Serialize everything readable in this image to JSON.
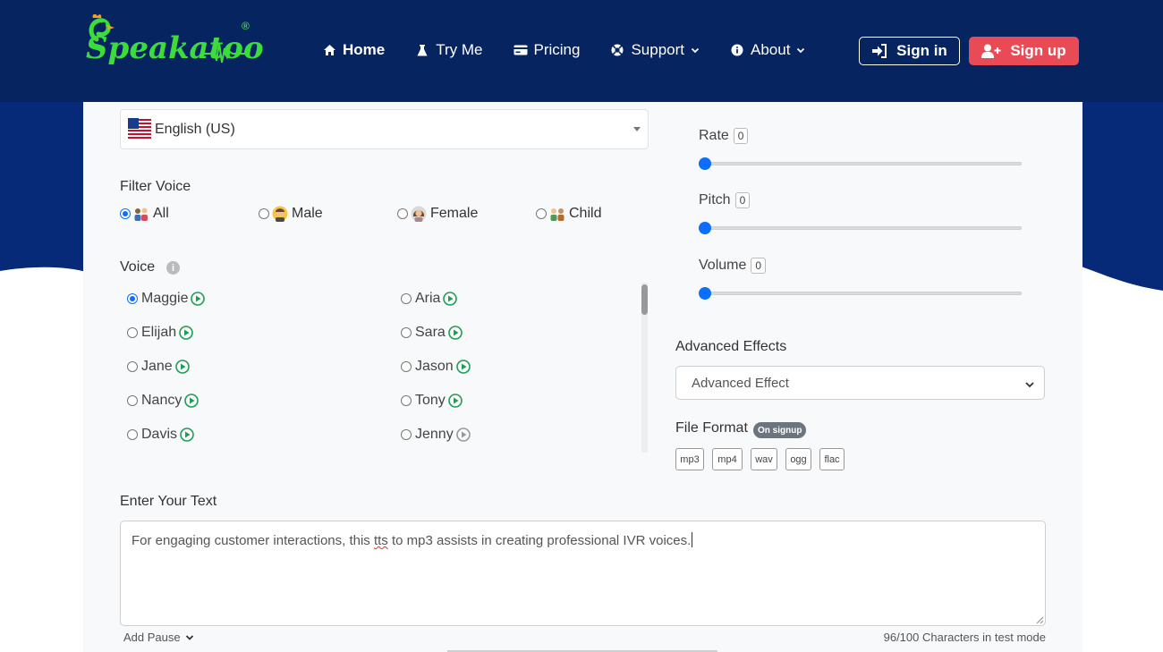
{
  "header": {
    "logo_text": "Speakatoo",
    "logo_reg": "®",
    "nav": [
      {
        "label": "Home",
        "icon": "home-icon"
      },
      {
        "label": "Try Me",
        "icon": "flask-icon"
      },
      {
        "label": "Pricing",
        "icon": "card-icon"
      },
      {
        "label": "Support",
        "icon": "lifebuoy-icon"
      },
      {
        "label": "About",
        "icon": "info-icon"
      }
    ],
    "signin_label": "Sign in",
    "signup_label": "Sign up"
  },
  "language": {
    "selected": "English (US)"
  },
  "filter": {
    "label": "Filter Voice",
    "options": [
      {
        "label": "All",
        "checked": true
      },
      {
        "label": "Male",
        "checked": false
      },
      {
        "label": "Female",
        "checked": false
      },
      {
        "label": "Child",
        "checked": false
      }
    ]
  },
  "voice": {
    "label": "Voice",
    "info": "i",
    "items": [
      {
        "name": "Maggie",
        "checked": true
      },
      {
        "name": "Aria",
        "checked": false
      },
      {
        "name": "Elijah",
        "checked": false
      },
      {
        "name": "Sara",
        "checked": false
      },
      {
        "name": "Jane",
        "checked": false
      },
      {
        "name": "Jason",
        "checked": false
      },
      {
        "name": "Nancy",
        "checked": false
      },
      {
        "name": "Tony",
        "checked": false
      },
      {
        "name": "Davis",
        "checked": false
      },
      {
        "name": "Jenny",
        "checked": false
      }
    ]
  },
  "sliders": {
    "rate": {
      "label": "Rate",
      "value": "0"
    },
    "pitch": {
      "label": "Pitch",
      "value": "0"
    },
    "volume": {
      "label": "Volume",
      "value": "0"
    }
  },
  "advanced": {
    "label": "Advanced Effects",
    "selected": "Advanced Effect"
  },
  "file_format": {
    "label": "File Format",
    "badge": "On signup",
    "formats": [
      "mp3",
      "mp4",
      "wav",
      "ogg",
      "flac"
    ]
  },
  "text": {
    "label": "Enter Your Text",
    "before": "For engaging customer interactions, this ",
    "misspelled": "tts",
    "after": " to mp3 assists in creating professional IVR voices.",
    "add_pause": "Add Pause",
    "char_count": "96/100 Characters in test mode"
  },
  "colors": {
    "header_bg": "#062460",
    "accent": "#0d6efd",
    "signup": "#e84b55",
    "logo_green": "#3ddc3d",
    "play_green": "#1f9d55"
  }
}
